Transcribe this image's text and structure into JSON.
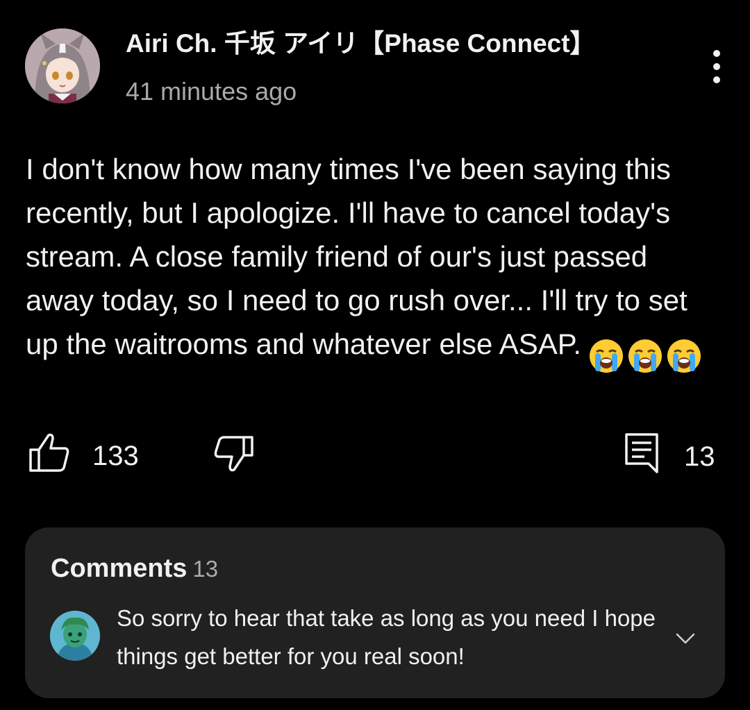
{
  "post": {
    "author": "Airi Ch. 千坂 アイリ【Phase Connect】",
    "time": "41 minutes ago",
    "text": "I don't know how many times I've been saying this recently, but I apologize. I'll have to cancel today's stream. A close family friend of our's just passed away today, so I need to go rush over... I'll try to set up the waitrooms and whatever else ASAP.",
    "emojis": [
      "loudly-crying-face-emoji",
      "loudly-crying-face-emoji",
      "loudly-crying-face-emoji"
    ]
  },
  "actions": {
    "like_count": "133",
    "comment_count": "13"
  },
  "comments": {
    "heading": "Comments",
    "count": "13",
    "top_comment": {
      "text": "So sorry to hear that take as long as you need I hope things get better for you real soon!"
    }
  },
  "icons": {
    "menu": "more-vert-icon",
    "like": "thumb-up-icon",
    "dislike": "thumb-down-icon",
    "comment": "comment-icon",
    "expand": "chevron-down-icon"
  },
  "colors": {
    "background": "#000000",
    "card": "#212121",
    "text": "#f1f1f1",
    "secondary_text": "#aaaaaa"
  }
}
